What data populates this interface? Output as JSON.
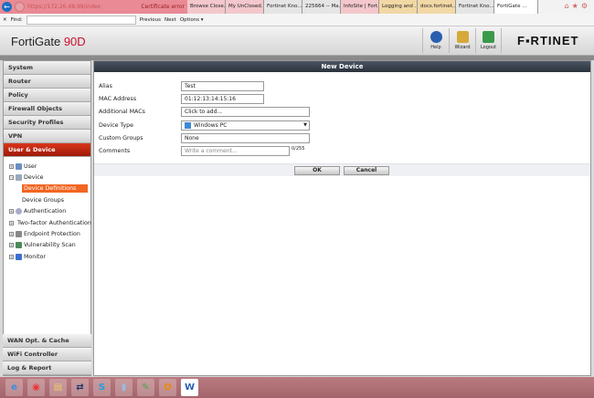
{
  "browser": {
    "url": "https://172.26.48.99/index",
    "cert": "Certificate error",
    "tabs": [
      "Browse Close...",
      "My UnClosed...",
      "Fortinet Kno...",
      "225664 -- Ma...",
      "InfoSite | Fort...",
      "Logging and ...",
      "docs.fortinet...",
      "Fortinet Kno...",
      "FortiGate ..."
    ],
    "find": {
      "label": "Find:",
      "previous": "Previous",
      "next": "Next",
      "options": "Options ▾"
    }
  },
  "header": {
    "brand": "FortiGate",
    "model": "90D",
    "help": "Help",
    "wizard": "Wizard",
    "logout": "Logout",
    "logo": "F▪RTINET"
  },
  "sidebar": {
    "top": [
      "System",
      "Router",
      "Policy",
      "Firewall Objects",
      "Security Profiles",
      "VPN",
      "User & Device"
    ],
    "tree": [
      "User",
      "Device",
      "Device Definitions",
      "Device Groups",
      "Authentication",
      "Two-factor Authentication",
      "Endpoint Protection",
      "Vulnerability Scan",
      "Monitor"
    ],
    "bottom": [
      "WAN Opt. & Cache",
      "WiFi Controller",
      "Log & Report"
    ]
  },
  "form": {
    "title": "New Device",
    "alias": {
      "label": "Alias",
      "value": "Test"
    },
    "mac": {
      "label": "MAC Address",
      "value": "01:12:13:14:15:16"
    },
    "additional": {
      "label": "Additional MACs",
      "value": "Click to add..."
    },
    "type": {
      "label": "Device Type",
      "value": "Windows PC"
    },
    "groups": {
      "label": "Custom Groups",
      "value": "None"
    },
    "comments": {
      "label": "Comments",
      "placeholder": "Write a comment...",
      "count": "0/255"
    },
    "ok": "OK",
    "cancel": "Cancel"
  },
  "taskbar": [
    "e",
    "◉",
    "▤",
    "⇄",
    "S",
    "▮",
    "✎",
    "O",
    "W"
  ]
}
